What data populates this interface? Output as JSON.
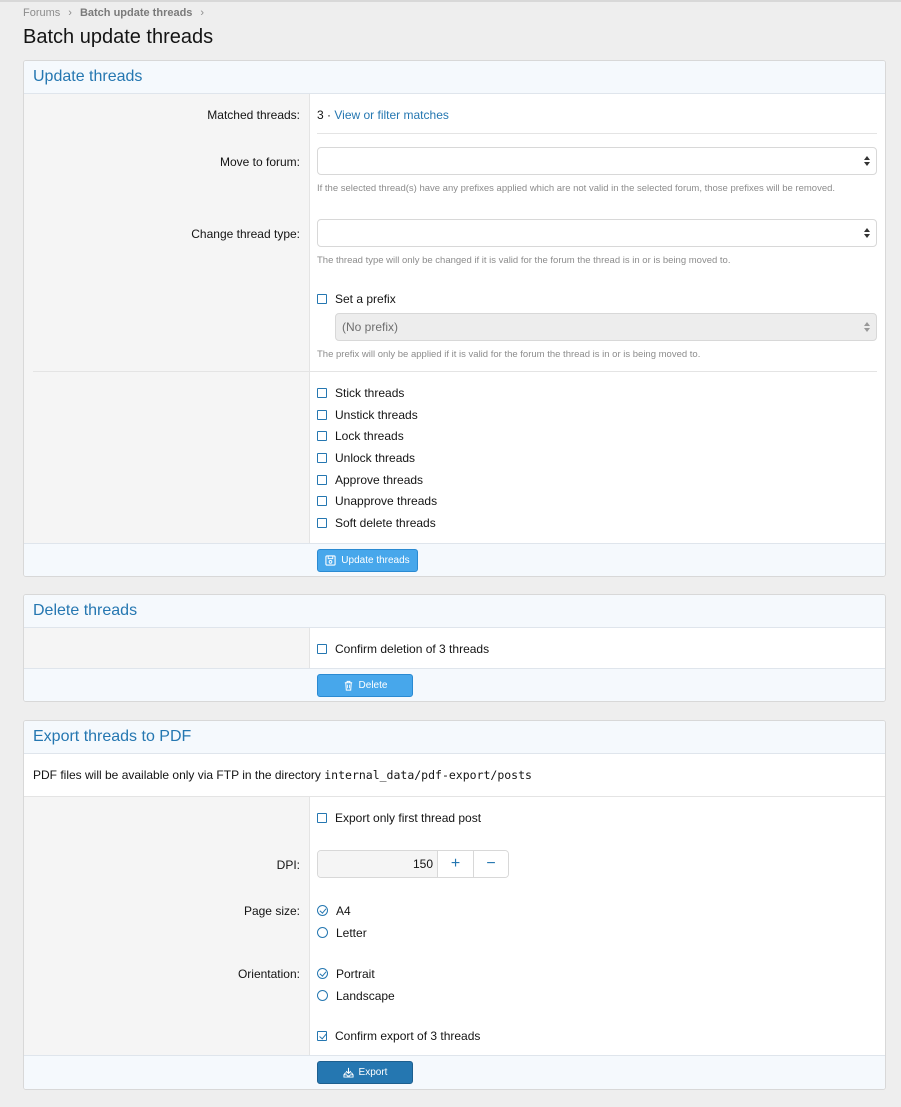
{
  "breadcrumb": {
    "forums": "Forums",
    "current": "Batch update threads"
  },
  "page_title": "Batch update threads",
  "update": {
    "header": "Update threads",
    "matched_label": "Matched threads:",
    "matched_count": "3",
    "matched_sep": "·",
    "matched_link": "View or filter matches",
    "move_label": "Move to forum:",
    "move_value": "",
    "move_hint": "If the selected thread(s) have any prefixes applied which are not valid in the selected forum, those prefixes will be removed.",
    "type_label": "Change thread type:",
    "type_value": "",
    "type_hint": "The thread type will only be changed if it is valid for the forum the thread is in or is being moved to.",
    "prefix_check": "Set a prefix",
    "prefix_select": "(No prefix)",
    "prefix_hint": "The prefix will only be applied if it is valid for the forum the thread is in or is being moved to.",
    "actions": [
      "Stick threads",
      "Unstick threads",
      "Lock threads",
      "Unlock threads",
      "Approve threads",
      "Unapprove threads",
      "Soft delete threads"
    ],
    "button": "Update threads"
  },
  "delete": {
    "header": "Delete threads",
    "confirm": "Confirm deletion of 3 threads",
    "button": "Delete"
  },
  "export": {
    "header": "Export threads to PDF",
    "note_text": "PDF files will be available only via FTP in the directory",
    "note_path": "internal_data/pdf-export/posts",
    "first_post": "Export only first thread post",
    "dpi_label": "DPI:",
    "dpi_value": "150",
    "plus": "+",
    "minus": "−",
    "page_size_label": "Page size:",
    "page_size_options": [
      "A4",
      "Letter"
    ],
    "page_size_selected": "A4",
    "orientation_label": "Orientation:",
    "orientation_options": [
      "Portrait",
      "Landscape"
    ],
    "orientation_selected": "Portrait",
    "confirm": "Confirm export of 3 threads",
    "confirm_checked": true,
    "button": "Export"
  },
  "colors": {
    "accent": "#2577b1",
    "button_light": "#47a7eb",
    "header_bg": "#f5f9fd"
  }
}
